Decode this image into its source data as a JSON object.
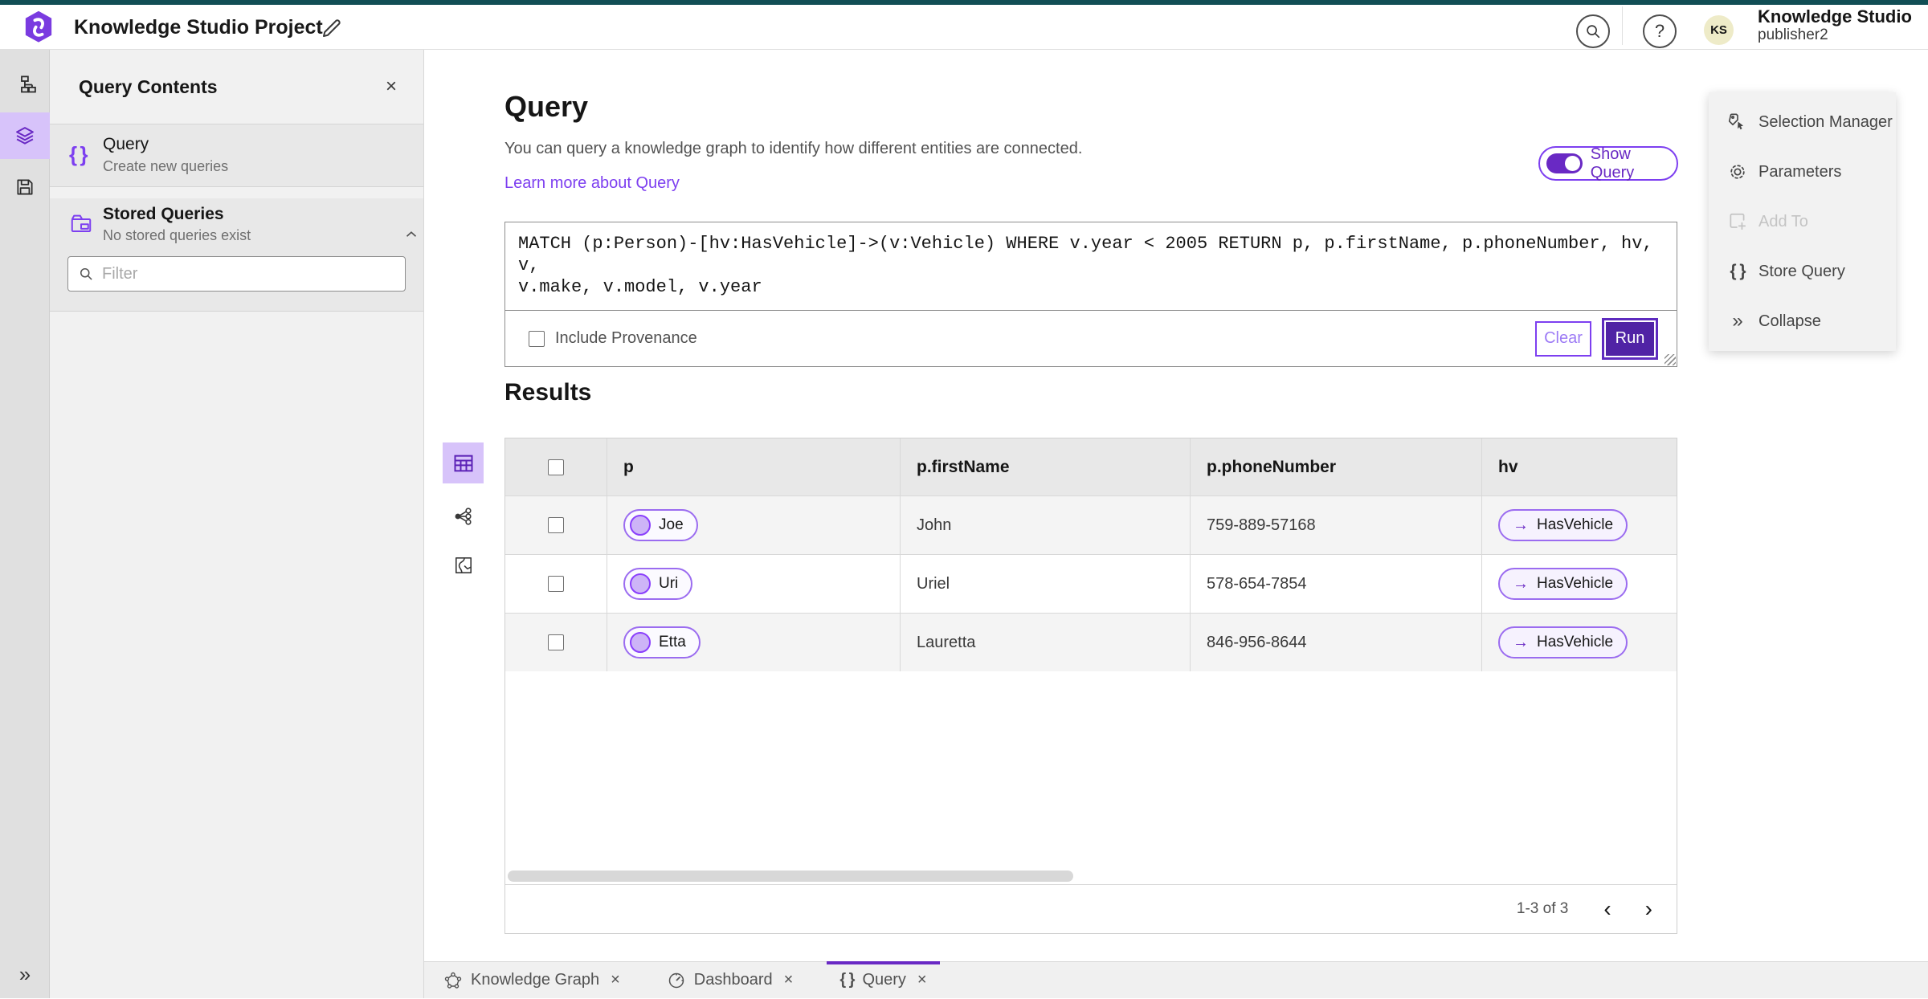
{
  "topbar": {
    "project_title": "Knowledge Studio Project",
    "account_name": "Knowledge Studio",
    "account_user": "publisher2",
    "avatar_initials": "KS"
  },
  "left_panel": {
    "title": "Query Contents",
    "query_item": {
      "label": "Query",
      "sublabel": "Create new queries"
    },
    "stored": {
      "label": "Stored Queries",
      "sublabel": "No stored queries exist"
    },
    "filter_placeholder": "Filter"
  },
  "main": {
    "title": "Query",
    "description": "You can query a knowledge graph to identify how different entities are connected.",
    "learn_link": "Learn more about Query",
    "show_query_label": "Show Query",
    "query_text": "MATCH (p:Person)-[hv:HasVehicle]->(v:Vehicle) WHERE v.year < 2005 RETURN p, p.firstName, p.phoneNumber, hv, v,\nv.make, v.model, v.year",
    "include_provenance": "Include Provenance",
    "clear_label": "Clear",
    "run_label": "Run",
    "results": {
      "title": "Results",
      "columns": [
        "p",
        "p.firstName",
        "p.phoneNumber",
        "hv"
      ],
      "rows": [
        {
          "p": "Joe",
          "firstName": "John",
          "phone": "759-889-57168",
          "hv": "HasVehicle"
        },
        {
          "p": "Uri",
          "firstName": "Uriel",
          "phone": "578-654-7854",
          "hv": "HasVehicle"
        },
        {
          "p": "Etta",
          "firstName": "Lauretta",
          "phone": "846-956-8644",
          "hv": "HasVehicle"
        }
      ],
      "pagination": "1-3 of 3"
    }
  },
  "right_panel": {
    "items": [
      {
        "label": "Selection Manager"
      },
      {
        "label": "Parameters"
      },
      {
        "label": "Add To"
      },
      {
        "label": "Store Query"
      },
      {
        "label": "Collapse"
      }
    ]
  },
  "tabs": [
    {
      "label": "Knowledge Graph"
    },
    {
      "label": "Dashboard"
    },
    {
      "label": "Query"
    }
  ],
  "icons": {
    "braces": "{ }",
    "close": "×",
    "help": "?",
    "collapse": "»",
    "rail_expand": "»",
    "arrow_right": "→",
    "prev": "‹",
    "next": "›"
  },
  "colors": {
    "accent_purple": "#7d3ff0",
    "accent_purple_dark": "#6929c4",
    "run_fill": "#5023a5",
    "selected_light_purple": "#d7c3fa",
    "teal_strip": "#114e55",
    "avatar_bg": "#eeebc8"
  }
}
